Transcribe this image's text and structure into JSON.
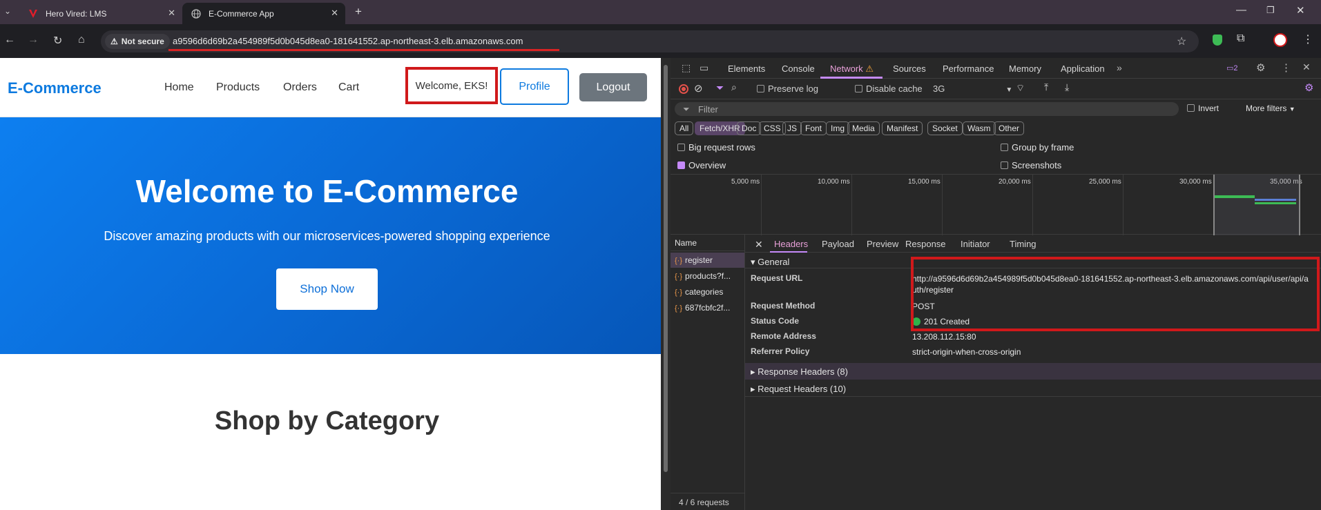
{
  "browser": {
    "tabs": [
      {
        "title": "Hero Vired: LMS",
        "favicon": "hero-vired-logo"
      },
      {
        "title": "E-Commerce App",
        "favicon": "globe-icon",
        "active": true
      }
    ],
    "new_tab_symbol": "+",
    "security_label": "Not secure",
    "url": "a9596d6d69b2a454989f5d0b045d8ea0-181641552.ap-northeast-3.elb.amazonaws.com"
  },
  "page": {
    "brand": "E-Commerce",
    "nav": [
      "Home",
      "Products",
      "Orders",
      "Cart"
    ],
    "welcome": "Welcome, EKS!",
    "profile_label": "Profile",
    "logout_label": "Logout",
    "hero_title": "Welcome to E-Commerce",
    "hero_subtitle": "Discover amazing products with our microservices-powered shopping experience",
    "cta_label": "Shop Now",
    "section_title": "Shop by Category",
    "colors": {
      "brand": "#0d7adf",
      "hero": "#0a6ad6",
      "logout": "#6c757d",
      "highlight": "#d0191b"
    }
  },
  "devtools": {
    "tabs": [
      "Elements",
      "Console",
      "Network",
      "Sources",
      "Performance",
      "Memory",
      "Application"
    ],
    "active_tab": "Network",
    "issues_count": "2",
    "toolbar": {
      "preserve_log": "Preserve log",
      "disable_cache": "Disable cache",
      "throttling": "3G"
    },
    "filter_placeholder": "Filter",
    "invert_label": "Invert",
    "more_filters": "More filters",
    "type_chips": [
      "All",
      "Fetch/XHR",
      "Doc",
      "CSS",
      "JS",
      "Font",
      "Img",
      "Media",
      "Manifest",
      "Socket",
      "Wasm",
      "Other"
    ],
    "active_chip": "Fetch/XHR",
    "options": {
      "big_rows": "Big request rows",
      "group_by_frame": "Group by frame",
      "overview": "Overview",
      "screenshots": "Screenshots"
    },
    "timeline_labels": [
      "5,000 ms",
      "10,000 ms",
      "15,000 ms",
      "20,000 ms",
      "25,000 ms",
      "30,000 ms",
      "35,000 ms"
    ],
    "requests_header": "Name",
    "requests": [
      "register",
      "products?f...",
      "categories",
      "687fcbfc2f..."
    ],
    "requests_footer": "4 / 6 requests",
    "detail_tabs": [
      "Headers",
      "Payload",
      "Preview",
      "Response",
      "Initiator",
      "Timing"
    ],
    "general": {
      "title": "General",
      "request_url_key": "Request URL",
      "request_url": "http://a9596d6d69b2a454989f5d0b045d8ea0-181641552.ap-northeast-3.elb.amazonaws.com/api/user/api/auth/register",
      "request_method_key": "Request Method",
      "request_method": "POST",
      "status_code_key": "Status Code",
      "status_code": "201 Created",
      "remote_address_key": "Remote Address",
      "remote_address": "13.208.112.15:80",
      "referrer_policy_key": "Referrer Policy",
      "referrer_policy": "strict-origin-when-cross-origin"
    },
    "response_headers": "Response Headers (8)",
    "request_headers": "Request Headers (10)"
  }
}
